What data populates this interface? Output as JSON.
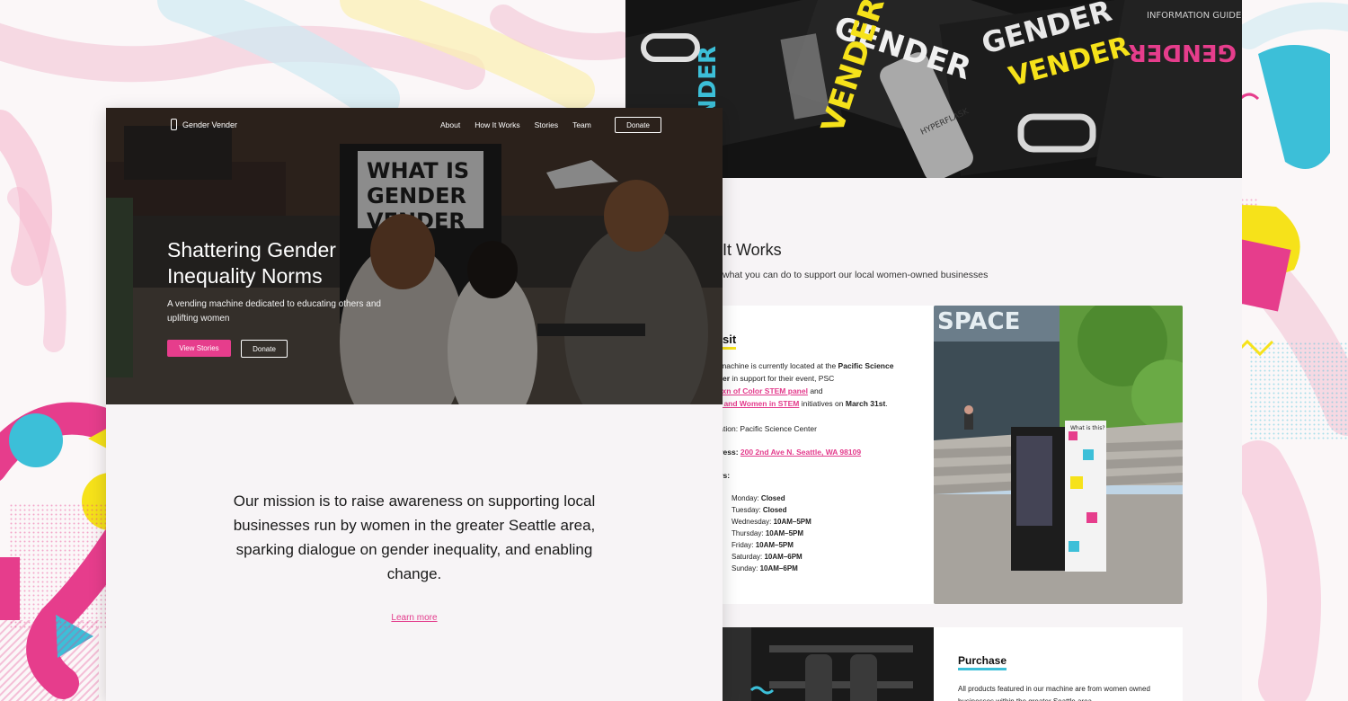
{
  "colors": {
    "pink": "#e63d8c",
    "yellow": "#f6e21a",
    "cyan": "#3cbfd8",
    "background": "#f7f4f6"
  },
  "front_page": {
    "nav": {
      "brand": "Gender Vender",
      "links": [
        "About",
        "How It Works",
        "Stories",
        "Team"
      ],
      "donate": "Donate"
    },
    "hero": {
      "title": "Shattering Gender Inequality Norms",
      "subtitle": "A vending machine dedicated to educating others and uplifting women",
      "primary_button": "View Stories",
      "secondary_button": "Donate"
    },
    "mission": {
      "text": "Our mission is to raise awareness on supporting local businesses run by women in the greater Seattle area, sparking dialogue on gender inequality, and enabling change.",
      "link": "Learn more"
    }
  },
  "back_page": {
    "how_it_works": {
      "title": "It Works",
      "subtitle": "what you can do to support our local women-owned businesses"
    },
    "visit": {
      "heading": "sit",
      "line1_pre": "r machine is currently located at the ",
      "line1_bold": "Pacific Science",
      "line2_bold": "nter",
      "line2_post": " in support for their event, PSC",
      "line3_link": "mxn of Color STEM panel",
      "line3_post": " and",
      "line4_link": "ls and Women in STEM",
      "line4_post": " initiatives on ",
      "line4_bold": "March 31st",
      "line4_end": ".",
      "location_label": "cation",
      "location_value": ": Pacific Science Center",
      "address_label": "dress",
      "address_value": "200 2nd Ave N. Seattle, WA 98109",
      "hours_label": "urs",
      "hours": [
        {
          "day": "Monday:",
          "time": "Closed"
        },
        {
          "day": "Tuesday:",
          "time": "Closed"
        },
        {
          "day": "Wednesday:",
          "time": "10AM–5PM"
        },
        {
          "day": "Thursday:",
          "time": "10AM–5PM"
        },
        {
          "day": "Friday:",
          "time": "10AM–5PM"
        },
        {
          "day": "Saturday:",
          "time": "10AM–6PM"
        },
        {
          "day": "Sunday:",
          "time": "10AM–6PM"
        }
      ],
      "photo_sign": "SPACE",
      "machine_label": "What is this?"
    },
    "purchase": {
      "heading": "Purchase",
      "text": "All products featured in our machine are from women owned businesses within the greater Seattle area."
    },
    "top_photo_words": [
      "GENDER",
      "VENDER",
      "INFORMATION GUIDE",
      "GENDER",
      "VENDER",
      "GENDER",
      "VENDER",
      "HYPERFLASK"
    ]
  },
  "hero_photo_sign": [
    "WHAT IS",
    "GENDER",
    "VENDER"
  ]
}
